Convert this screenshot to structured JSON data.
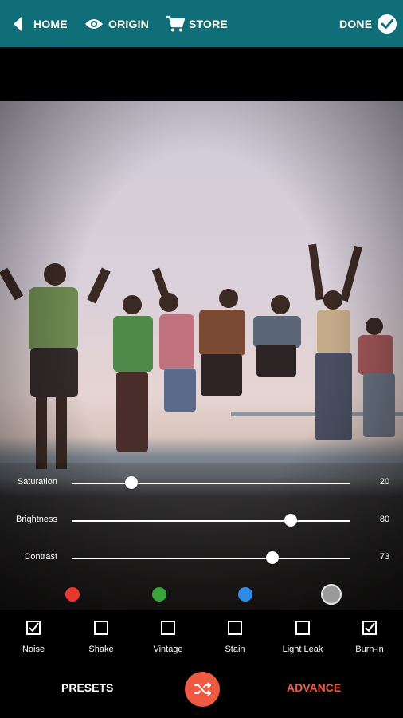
{
  "topbar": {
    "home_label": "HOME",
    "origin_label": "ORIGIN",
    "store_label": "STORE",
    "done_label": "DONE",
    "bg_color": "#0f6e78"
  },
  "adjustments": {
    "saturation": {
      "label": "Saturation",
      "value": "20",
      "level": 0.2
    },
    "brightness": {
      "label": "Brightness",
      "value": "80",
      "level": 0.8
    },
    "contrast": {
      "label": "Contrast",
      "value": "73",
      "level": 0.73
    }
  },
  "color_swatches": [
    "#e8372c",
    "#3aa33c",
    "#2f8ae6",
    "#9a9a9a"
  ],
  "effects": [
    {
      "label": "Noise",
      "checked": true
    },
    {
      "label": "Shake",
      "checked": false
    },
    {
      "label": "Vintage",
      "checked": false
    },
    {
      "label": "Stain",
      "checked": false
    },
    {
      "label": "Light Leak",
      "checked": false
    },
    {
      "label": "Burn-in",
      "checked": true
    }
  ],
  "bottombar": {
    "presets_label": "PRESETS",
    "advance_label": "ADVANCE",
    "active_color": "#ee5a43"
  }
}
